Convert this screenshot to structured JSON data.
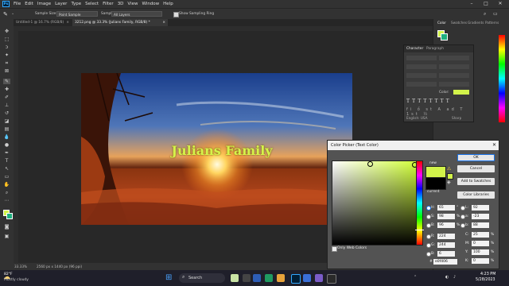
{
  "menubar": {
    "app": "Ps",
    "items": [
      "File",
      "Edit",
      "Image",
      "Layer",
      "Type",
      "Select",
      "Filter",
      "3D",
      "View",
      "Window",
      "Help"
    ]
  },
  "options": {
    "sample_size_label": "Sample Size:",
    "sample_size_value": "Point Sample",
    "sample_label": "Sample:",
    "sample_value": "All Layers",
    "show_ring_label": "Show Sampling Ring"
  },
  "tabs": [
    {
      "label": "Untitled-1 @ 16.7% (RGB/8)",
      "close": "×"
    },
    {
      "label": "3212.png @ 33.3% (Julians Family, RGB/8) *",
      "close": "×"
    }
  ],
  "canvas": {
    "text": "Julians Family"
  },
  "status": {
    "zoom": "33.33%",
    "doc_info": "2560 px x 1440 px (96 ppi)"
  },
  "dock_tabs": [
    "Color",
    "Swatches",
    "Gradients",
    "Patterns"
  ],
  "character_panel": {
    "tabs": [
      "Character",
      "Paragraph"
    ],
    "color_label": "Color:",
    "language": "English: USA",
    "aa": "Sharp",
    "color_hex": "#d2f34a"
  },
  "picker": {
    "title": "Color Picker (Text Color)",
    "new_label": "new",
    "current_label": "current",
    "buttons": [
      "OK",
      "Cancel",
      "Add to Swatches",
      "Color Libraries"
    ],
    "fields": [
      {
        "label": "H:",
        "value": "65",
        "unit": "°"
      },
      {
        "label": "S:",
        "value": "98",
        "unit": "%"
      },
      {
        "label": "B:",
        "value": "96",
        "unit": "%"
      },
      {
        "label": "R:",
        "value": "224",
        "unit": ""
      },
      {
        "label": "G:",
        "value": "244",
        "unit": ""
      },
      {
        "label": "B:",
        "value": "6",
        "unit": ""
      }
    ],
    "lab_fields": [
      {
        "label": "L:",
        "value": "92"
      },
      {
        "label": "a:",
        "value": "-23"
      },
      {
        "label": "b:",
        "value": "88"
      }
    ],
    "cmyk_fields": [
      {
        "label": "C:",
        "value": "25",
        "unit": "%"
      },
      {
        "label": "M:",
        "value": "0",
        "unit": "%"
      },
      {
        "label": "Y:",
        "value": "100",
        "unit": "%"
      },
      {
        "label": "K:",
        "value": "0",
        "unit": "%"
      }
    ],
    "hex_label": "#",
    "hex_value": "e0f406",
    "only_web_label": "Only Web Colors",
    "new_color": "#d2f34a",
    "current_color": "#000000"
  },
  "taskbar": {
    "weather_temp": "82°F",
    "weather_desc": "Mostly cloudy",
    "search_label": "Search",
    "time": "4:23 PM",
    "date": "5/28/2023"
  },
  "colors": {
    "accent": "#1a73e8",
    "ps_blue": "#31a8ff",
    "text_color": "#d6f34a"
  }
}
